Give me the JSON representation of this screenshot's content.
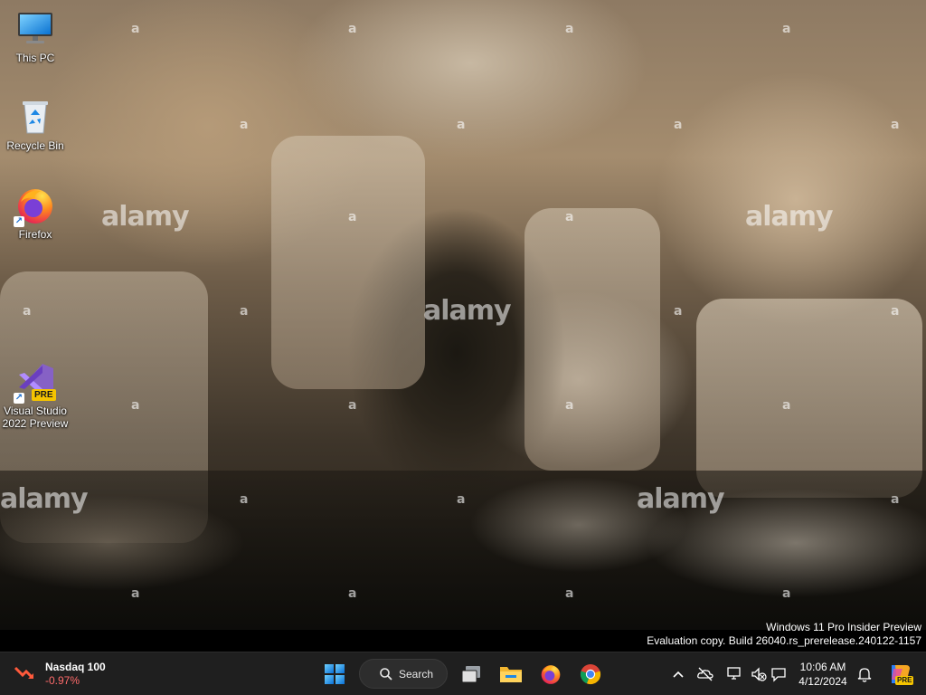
{
  "desktop": {
    "icons": [
      {
        "label": "This PC"
      },
      {
        "label": "Recycle Bin"
      },
      {
        "label": "Firefox"
      },
      {
        "label": "Visual Studio 2022 Preview",
        "badge": "PRE"
      }
    ],
    "watermark": "alamy",
    "watermark_letter": "a"
  },
  "eval_text": {
    "line1": "Windows 11 Pro Insider Preview",
    "line2": "Evaluation copy. Build 26040.rs_prerelease.240122-1157"
  },
  "taskbar": {
    "widget": {
      "title": "Nasdaq 100",
      "value": "-0.97%"
    },
    "search_label": "Search",
    "apps": [
      "start-icon",
      "task-view-icon",
      "file-explorer-icon",
      "firefox-icon",
      "chrome-icon"
    ],
    "clock": {
      "time": "10:06 AM",
      "date": "4/12/2024"
    },
    "copilot_badge": "PRE"
  },
  "colors": {
    "taskbar_bg": "#1f1f1f",
    "accent": "#0078d4",
    "stock_down": "#ff6b6b"
  }
}
